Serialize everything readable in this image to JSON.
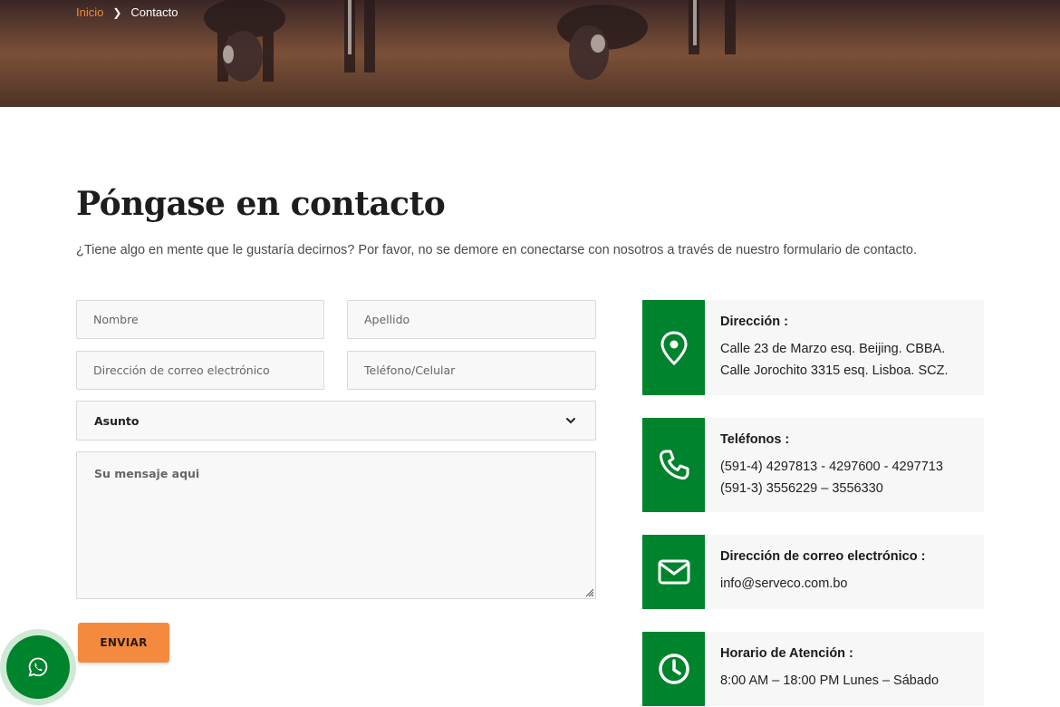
{
  "breadcrumb": {
    "home": "Inicio",
    "current": "Contacto"
  },
  "heading": "Póngase en contacto",
  "intro": "¿Tiene algo en mente que le gustaría decirnos? Por favor, no se demore en conectarse con nosotros a través de nuestro formulario de contacto.",
  "form": {
    "first_name_placeholder": "Nombre",
    "last_name_placeholder": "Apellido",
    "email_placeholder": "Dirección de correo electrónico",
    "phone_placeholder": "Teléfono/Celular",
    "subject_value": "Asunto",
    "message_placeholder": "Su mensaje aqui",
    "submit_label": "ENVIAR"
  },
  "contact_cards": [
    {
      "icon": "location-pin-icon",
      "title": "Dirección :",
      "lines": [
        "Calle 23 de Marzo esq. Beijing. CBBA.",
        "Calle Jorochito 3315 esq. Lisboa. SCZ."
      ]
    },
    {
      "icon": "phone-icon",
      "title": "Teléfonos :",
      "lines": [
        "(591-4) 4297813 - 4297600 - 4297713",
        "(591-3) 3556229 – 3556330"
      ]
    },
    {
      "icon": "envelope-icon",
      "title": "Dirección de correo electrónico :",
      "lines": [
        "info@serveco.com.bo"
      ]
    },
    {
      "icon": "clock-icon",
      "title": "Horario de Atención :",
      "lines": [
        "8:00 AM – 18:00 PM Lunes – Sábado"
      ]
    }
  ],
  "floating": {
    "icon": "whatsapp-icon"
  },
  "colors": {
    "accent_green": "#00832d",
    "accent_orange": "#f38a3e"
  }
}
